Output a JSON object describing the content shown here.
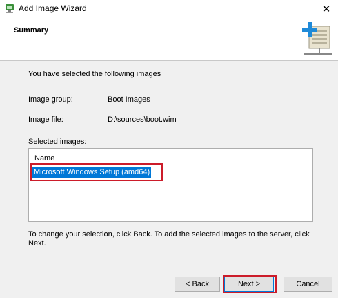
{
  "window": {
    "title": "Add Image Wizard",
    "close_glyph": "✕",
    "app_icon": "wizard-app-icon"
  },
  "header": {
    "title": "Summary",
    "icon": "server-add-icon"
  },
  "content": {
    "intro": "You have selected the following images",
    "image_group_label": "Image group:",
    "image_group_value": "Boot Images",
    "image_file_label": "Image file:",
    "image_file_value": "D:\\sources\\boot.wim",
    "selected_images_label": "Selected images:",
    "list": {
      "column_header": "Name",
      "items": [
        "Microsoft Windows Setup (amd64)"
      ]
    },
    "instructions": "To change your selection, click Back. To add the selected images to the server, click Next."
  },
  "buttons": {
    "back": "< Back",
    "next": "Next >",
    "cancel": "Cancel"
  },
  "colors": {
    "selection": "#0078d7",
    "highlight_annotation": "#cc1c2a"
  }
}
